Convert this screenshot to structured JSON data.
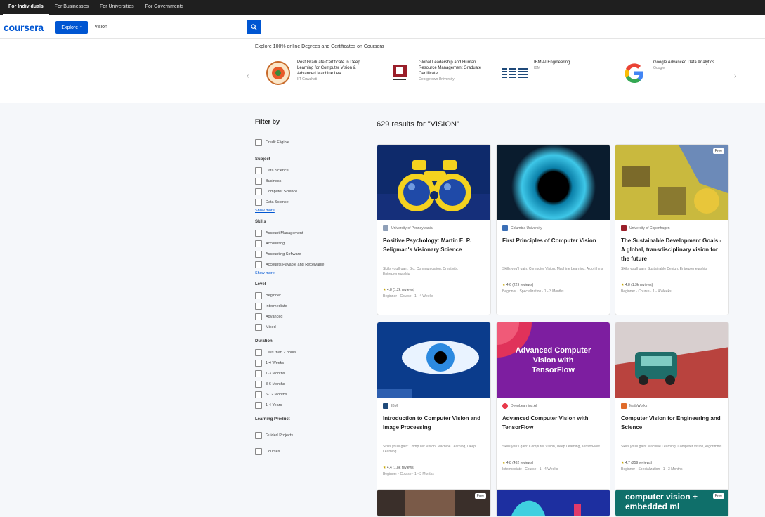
{
  "topnav": [
    "For Individuals",
    "For Businesses",
    "For Universities",
    "For Governments"
  ],
  "header": {
    "logo": "coursera",
    "explore": "Explore",
    "search_value": "vision"
  },
  "degrees": {
    "title": "Explore 100% online Degrees and Certificates on Coursera",
    "items": [
      {
        "name": "Post Graduate Certificate in Deep Learning for Computer Vision & Advanced Machine Lea",
        "sub": "IIT Guwahati"
      },
      {
        "name": "Global Leadership and Human Resource Management Graduate Certificate",
        "sub": "Georgetown University"
      },
      {
        "name": "IBM AI Engineering",
        "sub": "IBM"
      },
      {
        "name": "Google Advanced Data Analytics",
        "sub": "Google"
      }
    ]
  },
  "filters": {
    "title": "Filter by",
    "top_option": "Credit Eligible",
    "groups": [
      {
        "title": "Subject",
        "options": [
          "Data Science",
          "Business",
          "Computer Science",
          "Data Science"
        ],
        "more": "Show more"
      },
      {
        "title": "Skills",
        "options": [
          "Account Management",
          "Accounting",
          "Accounting Software",
          "Accounts Payable and Receivable"
        ],
        "more": "Show more"
      },
      {
        "title": "Level",
        "options": [
          "Beginner",
          "Intermediate",
          "Advanced",
          "Mixed"
        ]
      },
      {
        "title": "Duration",
        "options": [
          "Less than 2 hours",
          "1-4 Weeks",
          "1-3 Months",
          "3-6 Months",
          "6-12 Months",
          "1-4 Years"
        ]
      },
      {
        "title": "Learning Product",
        "options": [
          "Guided Projects",
          "Courses"
        ]
      }
    ]
  },
  "results": {
    "title": "629 results for \"VISION\"",
    "cards": [
      {
        "partner": "University of Pennsylvania",
        "title": "Positive Psychology: Martin E. P. Seligman's Visionary Science",
        "skills": "Skills you'll gain: Bio, Communication, Creativity, Entrepreneurship",
        "rating": "4.8",
        "reviews": "(1.2k reviews)",
        "meta": "Beginner · Course · 1 - 4 Weeks",
        "badge": ""
      },
      {
        "partner": "Columbia University",
        "title": "First Principles of Computer Vision",
        "skills": "Skills you'll gain: Computer Vision, Machine Learning, Algorithms",
        "rating": "4.6",
        "reviews": "(229 reviews)",
        "meta": "Beginner · Specialization · 1 - 3 Months",
        "badge": ""
      },
      {
        "partner": "University of Copenhagen",
        "title": "The Sustainable Development Goals - A global, transdisciplinary vision for the future",
        "skills": "Skills you'll gain: Sustainable Design, Entrepreneurship",
        "rating": "4.8",
        "reviews": "(1.3k reviews)",
        "meta": "Beginner · Course · 1 - 4 Weeks",
        "badge": "Free"
      },
      {
        "partner": "IBM",
        "title": "Introduction to Computer Vision and Image Processing",
        "skills": "Skills you'll gain: Computer Vision, Machine Learning, Deep Learning",
        "rating": "4.4",
        "reviews": "(1.8k reviews)",
        "meta": "Beginner · Course · 1 - 3 Months",
        "badge": ""
      },
      {
        "partner": "DeepLearning.AI",
        "title": "Advanced Computer Vision with TensorFlow",
        "skills": "Skills you'll gain: Computer Vision, Deep Learning, TensorFlow",
        "rating": "4.8",
        "reviews": "(432 reviews)",
        "meta": "Intermediate · Course · 1 - 4 Weeks",
        "badge": ""
      },
      {
        "partner": "MathWorks",
        "title": "Computer Vision for Engineering and Science",
        "skills": "Skills you'll gain: Machine Learning, Computer Vision, Algorithms",
        "rating": "4.7",
        "reviews": "(259 reviews)",
        "meta": "Beginner · Specialization · 1 - 3 Months",
        "badge": ""
      }
    ],
    "image_text": {
      "card5": "Advanced Computer Vision with TensorFlow",
      "card9": "computer vision + embedded ml"
    },
    "row3_badges": [
      "Free",
      "Free"
    ]
  }
}
